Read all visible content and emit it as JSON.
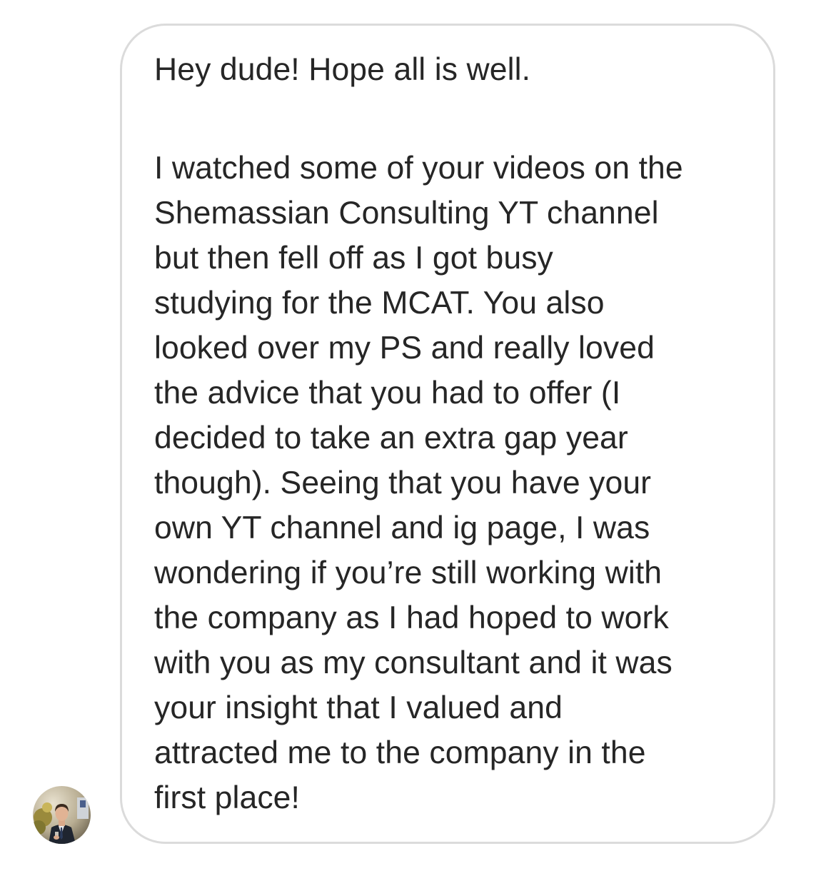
{
  "message": {
    "sender_avatar": "avatar-photo",
    "lines": [
      "Hey dude! Hope all is well.",
      "",
      "I watched some of your videos on the",
      "Shemassian Consulting YT channel",
      "but then fell off as I got busy",
      "studying for the MCAT. You also",
      "looked over my PS and really loved",
      "the advice that you had to offer (I",
      "decided to take an extra gap year",
      "though). Seeing that you have your",
      "own YT channel and ig page, I was",
      "wondering if you’re still working with",
      "the company as I had hoped to work",
      "with you as my consultant and it was",
      "your insight that I valued and",
      "attracted me to the company in the",
      "first place!"
    ]
  },
  "colors": {
    "text": "#262626",
    "bubble_border": "#dbdbdb",
    "background": "#ffffff"
  }
}
